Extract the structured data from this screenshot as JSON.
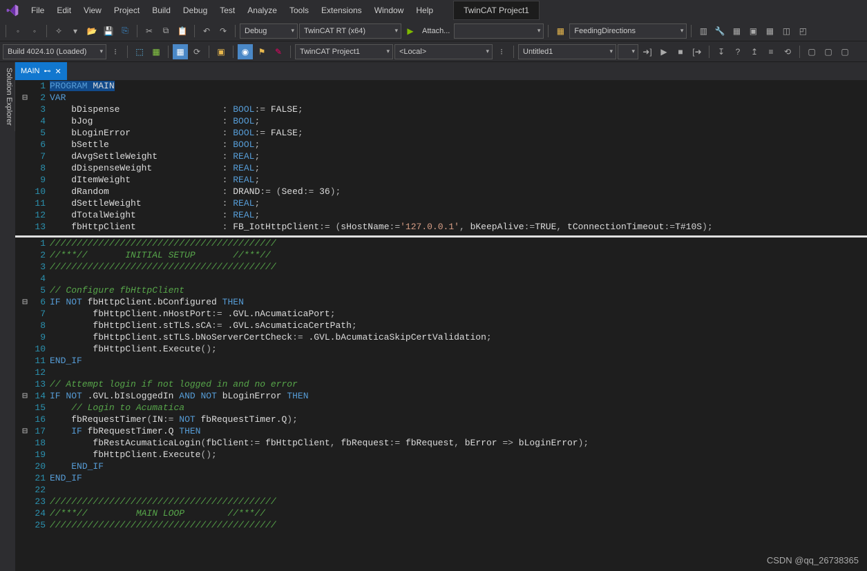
{
  "menus": [
    "File",
    "Edit",
    "View",
    "Project",
    "Build",
    "Debug",
    "Test",
    "Analyze",
    "Tools",
    "Extensions",
    "Window",
    "Help"
  ],
  "title": "TwinCAT Project1",
  "toolbar1": {
    "config": "Debug",
    "platform": "TwinCAT RT (x64)",
    "attach": "Attach...",
    "classDrop": "FeedingDirections"
  },
  "toolbar2": {
    "build": "Build 4024.10 (Loaded)",
    "project": "TwinCAT Project1",
    "target": "<Local>",
    "untitled": "Untitled1"
  },
  "sideTab": "Solution Explorer",
  "tab": {
    "name": "MAIN"
  },
  "watermark": "CSDN @qq_26738365",
  "code_top": [
    {
      "n": 1,
      "f": "",
      "t": [
        [
          "kw",
          "PROGRAM"
        ],
        [
          "txt",
          " MAIN"
        ]
      ],
      "hl": true
    },
    {
      "n": 2,
      "f": "⊟",
      "t": [
        [
          "kw",
          "VAR"
        ]
      ]
    },
    {
      "n": 3,
      "f": "",
      "t": [
        [
          "txt",
          "    bDispense                   "
        ],
        [
          "op",
          ": "
        ],
        [
          "type",
          "BOOL"
        ],
        [
          "op",
          ":= "
        ],
        [
          "txt",
          "FALSE"
        ],
        [
          "op",
          ";"
        ]
      ]
    },
    {
      "n": 4,
      "f": "",
      "t": [
        [
          "txt",
          "    bJog                        "
        ],
        [
          "op",
          ": "
        ],
        [
          "type",
          "BOOL"
        ],
        [
          "op",
          ";"
        ]
      ]
    },
    {
      "n": 5,
      "f": "",
      "t": [
        [
          "txt",
          "    bLoginError                 "
        ],
        [
          "op",
          ": "
        ],
        [
          "type",
          "BOOL"
        ],
        [
          "op",
          ":= "
        ],
        [
          "txt",
          "FALSE"
        ],
        [
          "op",
          ";"
        ]
      ]
    },
    {
      "n": 6,
      "f": "",
      "t": [
        [
          "txt",
          "    bSettle                     "
        ],
        [
          "op",
          ": "
        ],
        [
          "type",
          "BOOL"
        ],
        [
          "op",
          ";"
        ]
      ]
    },
    {
      "n": 7,
      "f": "",
      "t": [
        [
          "txt",
          "    dAvgSettleWeight            "
        ],
        [
          "op",
          ": "
        ],
        [
          "type",
          "REAL"
        ],
        [
          "op",
          ";"
        ]
      ]
    },
    {
      "n": 8,
      "f": "",
      "t": [
        [
          "txt",
          "    dDispenseWeight             "
        ],
        [
          "op",
          ": "
        ],
        [
          "type",
          "REAL"
        ],
        [
          "op",
          ";"
        ]
      ]
    },
    {
      "n": 9,
      "f": "",
      "t": [
        [
          "txt",
          "    dItemWeight                 "
        ],
        [
          "op",
          ": "
        ],
        [
          "type",
          "REAL"
        ],
        [
          "op",
          ";"
        ]
      ]
    },
    {
      "n": 10,
      "f": "",
      "t": [
        [
          "txt",
          "    dRandom                     "
        ],
        [
          "op",
          ": "
        ],
        [
          "txt",
          "DRAND"
        ],
        [
          "op",
          ":= ("
        ],
        [
          "txt",
          "Seed"
        ],
        [
          "op",
          ":= "
        ],
        [
          "txt",
          "36"
        ],
        [
          "op",
          ");"
        ]
      ]
    },
    {
      "n": 11,
      "f": "",
      "t": [
        [
          "txt",
          "    dSettleWeight               "
        ],
        [
          "op",
          ": "
        ],
        [
          "type",
          "REAL"
        ],
        [
          "op",
          ";"
        ]
      ]
    },
    {
      "n": 12,
      "f": "",
      "t": [
        [
          "txt",
          "    dTotalWeight                "
        ],
        [
          "op",
          ": "
        ],
        [
          "type",
          "REAL"
        ],
        [
          "op",
          ";"
        ]
      ]
    },
    {
      "n": 13,
      "f": "",
      "t": [
        [
          "txt",
          "    fbHttpClient                "
        ],
        [
          "op",
          ": "
        ],
        [
          "txt",
          "FB_IotHttpClient"
        ],
        [
          "op",
          ":= ("
        ],
        [
          "txt",
          "sHostName"
        ],
        [
          "op",
          ":="
        ],
        [
          "str",
          "'127.0.0.1'"
        ],
        [
          "op",
          ", "
        ],
        [
          "txt",
          "bKeepAlive"
        ],
        [
          "op",
          ":="
        ],
        [
          "txt",
          "TRUE"
        ],
        [
          "op",
          ", "
        ],
        [
          "txt",
          "tConnectionTimeout"
        ],
        [
          "op",
          ":="
        ],
        [
          "txt",
          "T#10S"
        ],
        [
          "op",
          ");"
        ]
      ]
    }
  ],
  "code_bottom": [
    {
      "n": 1,
      "f": "",
      "t": [
        [
          "cmt",
          "//////////////////////////////////////////"
        ]
      ]
    },
    {
      "n": 2,
      "f": "",
      "t": [
        [
          "cmt",
          "//***//       INITIAL SETUP       //***//"
        ]
      ]
    },
    {
      "n": 3,
      "f": "",
      "t": [
        [
          "cmt",
          "//////////////////////////////////////////"
        ]
      ]
    },
    {
      "n": 4,
      "f": "",
      "t": [
        [
          "txt",
          ""
        ]
      ]
    },
    {
      "n": 5,
      "f": "",
      "t": [
        [
          "cmt",
          "// Configure fbHttpClient"
        ]
      ]
    },
    {
      "n": 6,
      "f": "⊟",
      "t": [
        [
          "kw",
          "IF"
        ],
        [
          "txt",
          " "
        ],
        [
          "kw",
          "NOT"
        ],
        [
          "txt",
          " fbHttpClient.bConfigured "
        ],
        [
          "kw",
          "THEN"
        ]
      ]
    },
    {
      "n": 7,
      "f": "",
      "t": [
        [
          "txt",
          "        fbHttpClient.nHostPort"
        ],
        [
          "op",
          ":= "
        ],
        [
          "txt",
          ".GVL.nAcumaticaPort"
        ],
        [
          "op",
          ";"
        ]
      ]
    },
    {
      "n": 8,
      "f": "",
      "t": [
        [
          "txt",
          "        fbHttpClient.stTLS.sCA"
        ],
        [
          "op",
          ":= "
        ],
        [
          "txt",
          ".GVL.sAcumaticaCertPath"
        ],
        [
          "op",
          ";"
        ]
      ]
    },
    {
      "n": 9,
      "f": "",
      "t": [
        [
          "txt",
          "        fbHttpClient.stTLS.bNoServerCertCheck"
        ],
        [
          "op",
          ":= "
        ],
        [
          "txt",
          ".GVL.bAcumaticaSkipCertValidation"
        ],
        [
          "op",
          ";"
        ]
      ]
    },
    {
      "n": 10,
      "f": "",
      "t": [
        [
          "txt",
          "        fbHttpClient.Execute"
        ],
        [
          "op",
          "();"
        ]
      ]
    },
    {
      "n": 11,
      "f": "",
      "t": [
        [
          "kw",
          "END_IF"
        ]
      ]
    },
    {
      "n": 12,
      "f": "",
      "t": [
        [
          "txt",
          ""
        ]
      ]
    },
    {
      "n": 13,
      "f": "",
      "t": [
        [
          "cmt",
          "// Attempt login if not logged in and no error"
        ]
      ]
    },
    {
      "n": 14,
      "f": "⊟",
      "t": [
        [
          "kw",
          "IF"
        ],
        [
          "txt",
          " "
        ],
        [
          "kw",
          "NOT"
        ],
        [
          "txt",
          " .GVL.bIsLoggedIn "
        ],
        [
          "kw",
          "AND"
        ],
        [
          "txt",
          " "
        ],
        [
          "kw",
          "NOT"
        ],
        [
          "txt",
          " bLoginError "
        ],
        [
          "kw",
          "THEN"
        ]
      ]
    },
    {
      "n": 15,
      "f": "",
      "t": [
        [
          "txt",
          "    "
        ],
        [
          "cmt",
          "// Login to Acumatica"
        ]
      ]
    },
    {
      "n": 16,
      "f": "",
      "t": [
        [
          "txt",
          "    fbRequestTimer"
        ],
        [
          "op",
          "("
        ],
        [
          "txt",
          "IN"
        ],
        [
          "op",
          ":= "
        ],
        [
          "kw",
          "NOT"
        ],
        [
          "txt",
          " fbRequestTimer.Q"
        ],
        [
          "op",
          ");"
        ]
      ]
    },
    {
      "n": 17,
      "f": "⊟",
      "t": [
        [
          "txt",
          "    "
        ],
        [
          "kw",
          "IF"
        ],
        [
          "txt",
          " fbRequestTimer.Q "
        ],
        [
          "kw",
          "THEN"
        ]
      ]
    },
    {
      "n": 18,
      "f": "",
      "t": [
        [
          "txt",
          "        fbRestAcumaticaLogin"
        ],
        [
          "op",
          "("
        ],
        [
          "txt",
          "fbClient"
        ],
        [
          "op",
          ":= "
        ],
        [
          "txt",
          "fbHttpClient"
        ],
        [
          "op",
          ", "
        ],
        [
          "txt",
          "fbRequest"
        ],
        [
          "op",
          ":= "
        ],
        [
          "txt",
          "fbRequest"
        ],
        [
          "op",
          ", "
        ],
        [
          "txt",
          "bError "
        ],
        [
          "op",
          "=> "
        ],
        [
          "txt",
          "bLoginError"
        ],
        [
          "op",
          ");"
        ]
      ]
    },
    {
      "n": 19,
      "f": "",
      "t": [
        [
          "txt",
          "        fbHttpClient.Execute"
        ],
        [
          "op",
          "();"
        ]
      ]
    },
    {
      "n": 20,
      "f": "",
      "t": [
        [
          "txt",
          "    "
        ],
        [
          "kw",
          "END_IF"
        ]
      ]
    },
    {
      "n": 21,
      "f": "",
      "t": [
        [
          "kw",
          "END_IF"
        ]
      ]
    },
    {
      "n": 22,
      "f": "",
      "t": [
        [
          "txt",
          ""
        ]
      ]
    },
    {
      "n": 23,
      "f": "",
      "t": [
        [
          "cmt",
          "//////////////////////////////////////////"
        ]
      ]
    },
    {
      "n": 24,
      "f": "",
      "t": [
        [
          "cmt",
          "//***//         MAIN LOOP        //***//"
        ]
      ]
    },
    {
      "n": 25,
      "f": "",
      "t": [
        [
          "cmt",
          "//////////////////////////////////////////"
        ]
      ]
    }
  ]
}
